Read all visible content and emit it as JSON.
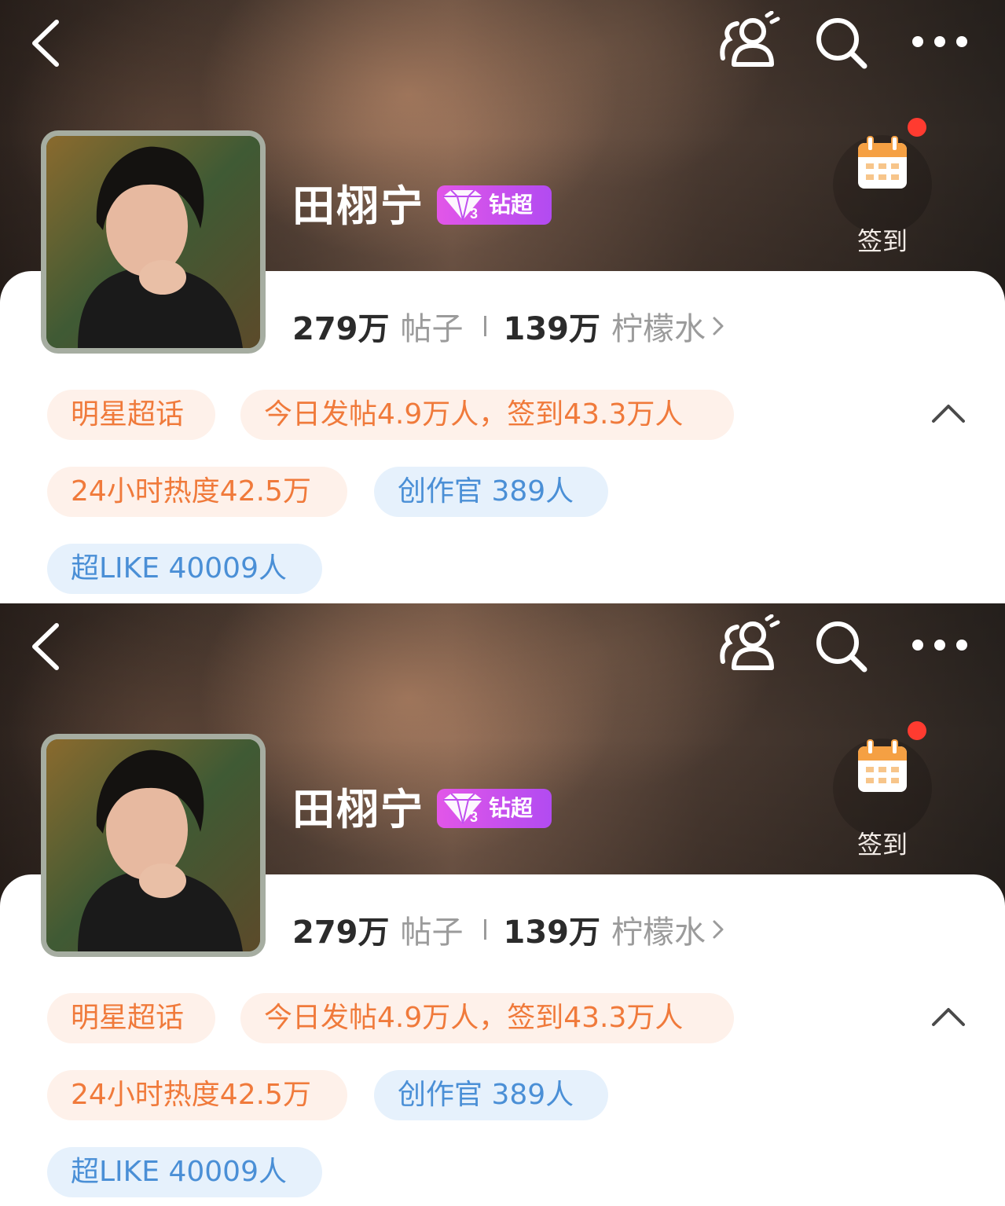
{
  "header": {
    "back_icon": "chevron-left-icon",
    "friends_icon": "friends-icon",
    "search_icon": "search-icon",
    "more_icon": "more-dots-icon"
  },
  "topic": {
    "name": "田栩宁",
    "badge_label": "钻超",
    "badge_level": "3"
  },
  "checkin": {
    "label": "签到",
    "has_notification": true
  },
  "stats": {
    "posts_count": "279万",
    "posts_label": "帖子",
    "fans_count": "139万",
    "fans_label": "柠檬水"
  },
  "tags": {
    "type": "明星超话",
    "today": "今日发帖4.9万人，签到43.3万人",
    "heat": "24小时热度42.5万",
    "creators": "创作官 389人",
    "super_like": "超LIKE 40009人"
  },
  "colors": {
    "accent_orange": "#f07a3b",
    "accent_blue": "#4a8fd6",
    "badge_purple": "#c04ff0",
    "notification_red": "#ff3b30"
  }
}
